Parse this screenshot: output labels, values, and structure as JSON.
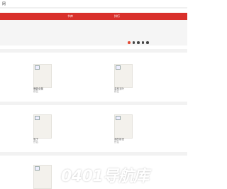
{
  "header": {
    "logo_text": "网"
  },
  "nav": {
    "items": [
      {
        "label": ""
      },
      {
        "label": "书库"
      },
      {
        "label": "排行"
      },
      {
        "label": ""
      }
    ]
  },
  "banner": {
    "dots": 5,
    "active_dot": 0
  },
  "sections": [
    {
      "books": [
        {
          "title": "鹿鼎全集",
          "author": "佚名"
        },
        {
          "title": "金枝玉叶",
          "author": "佚名"
        }
      ]
    },
    {
      "books": [
        {
          "title": "瓶子",
          "author": "佚名"
        },
        {
          "title": "我的前世",
          "author": "佚名"
        }
      ]
    },
    {
      "books": [
        {
          "title": "",
          "author": ""
        }
      ]
    }
  ],
  "watermark": {
    "text": "0401导航库"
  },
  "colors": {
    "nav_red": "#d9302b",
    "dot_active": "#e24b35"
  }
}
